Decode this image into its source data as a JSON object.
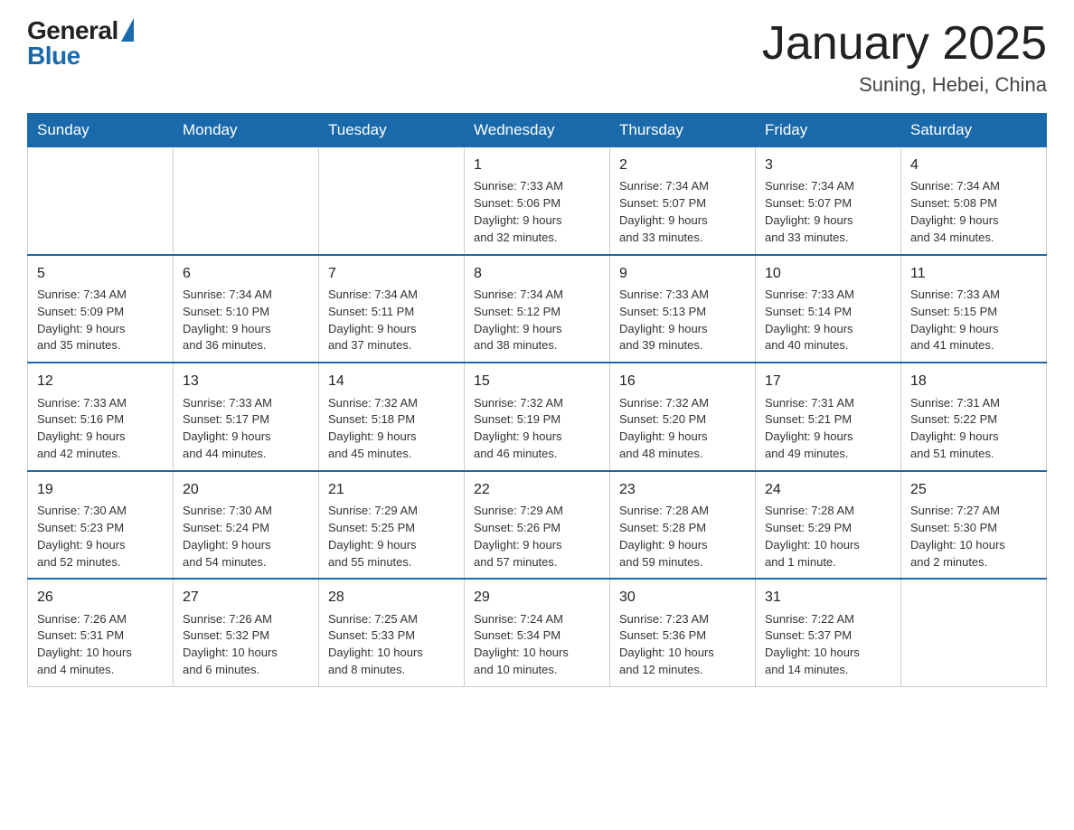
{
  "header": {
    "logo_general": "General",
    "logo_blue": "Blue",
    "month_title": "January 2025",
    "location": "Suning, Hebei, China"
  },
  "weekdays": [
    "Sunday",
    "Monday",
    "Tuesday",
    "Wednesday",
    "Thursday",
    "Friday",
    "Saturday"
  ],
  "weeks": [
    [
      {
        "day": "",
        "info": ""
      },
      {
        "day": "",
        "info": ""
      },
      {
        "day": "",
        "info": ""
      },
      {
        "day": "1",
        "info": "Sunrise: 7:33 AM\nSunset: 5:06 PM\nDaylight: 9 hours\nand 32 minutes."
      },
      {
        "day": "2",
        "info": "Sunrise: 7:34 AM\nSunset: 5:07 PM\nDaylight: 9 hours\nand 33 minutes."
      },
      {
        "day": "3",
        "info": "Sunrise: 7:34 AM\nSunset: 5:07 PM\nDaylight: 9 hours\nand 33 minutes."
      },
      {
        "day": "4",
        "info": "Sunrise: 7:34 AM\nSunset: 5:08 PM\nDaylight: 9 hours\nand 34 minutes."
      }
    ],
    [
      {
        "day": "5",
        "info": "Sunrise: 7:34 AM\nSunset: 5:09 PM\nDaylight: 9 hours\nand 35 minutes."
      },
      {
        "day": "6",
        "info": "Sunrise: 7:34 AM\nSunset: 5:10 PM\nDaylight: 9 hours\nand 36 minutes."
      },
      {
        "day": "7",
        "info": "Sunrise: 7:34 AM\nSunset: 5:11 PM\nDaylight: 9 hours\nand 37 minutes."
      },
      {
        "day": "8",
        "info": "Sunrise: 7:34 AM\nSunset: 5:12 PM\nDaylight: 9 hours\nand 38 minutes."
      },
      {
        "day": "9",
        "info": "Sunrise: 7:33 AM\nSunset: 5:13 PM\nDaylight: 9 hours\nand 39 minutes."
      },
      {
        "day": "10",
        "info": "Sunrise: 7:33 AM\nSunset: 5:14 PM\nDaylight: 9 hours\nand 40 minutes."
      },
      {
        "day": "11",
        "info": "Sunrise: 7:33 AM\nSunset: 5:15 PM\nDaylight: 9 hours\nand 41 minutes."
      }
    ],
    [
      {
        "day": "12",
        "info": "Sunrise: 7:33 AM\nSunset: 5:16 PM\nDaylight: 9 hours\nand 42 minutes."
      },
      {
        "day": "13",
        "info": "Sunrise: 7:33 AM\nSunset: 5:17 PM\nDaylight: 9 hours\nand 44 minutes."
      },
      {
        "day": "14",
        "info": "Sunrise: 7:32 AM\nSunset: 5:18 PM\nDaylight: 9 hours\nand 45 minutes."
      },
      {
        "day": "15",
        "info": "Sunrise: 7:32 AM\nSunset: 5:19 PM\nDaylight: 9 hours\nand 46 minutes."
      },
      {
        "day": "16",
        "info": "Sunrise: 7:32 AM\nSunset: 5:20 PM\nDaylight: 9 hours\nand 48 minutes."
      },
      {
        "day": "17",
        "info": "Sunrise: 7:31 AM\nSunset: 5:21 PM\nDaylight: 9 hours\nand 49 minutes."
      },
      {
        "day": "18",
        "info": "Sunrise: 7:31 AM\nSunset: 5:22 PM\nDaylight: 9 hours\nand 51 minutes."
      }
    ],
    [
      {
        "day": "19",
        "info": "Sunrise: 7:30 AM\nSunset: 5:23 PM\nDaylight: 9 hours\nand 52 minutes."
      },
      {
        "day": "20",
        "info": "Sunrise: 7:30 AM\nSunset: 5:24 PM\nDaylight: 9 hours\nand 54 minutes."
      },
      {
        "day": "21",
        "info": "Sunrise: 7:29 AM\nSunset: 5:25 PM\nDaylight: 9 hours\nand 55 minutes."
      },
      {
        "day": "22",
        "info": "Sunrise: 7:29 AM\nSunset: 5:26 PM\nDaylight: 9 hours\nand 57 minutes."
      },
      {
        "day": "23",
        "info": "Sunrise: 7:28 AM\nSunset: 5:28 PM\nDaylight: 9 hours\nand 59 minutes."
      },
      {
        "day": "24",
        "info": "Sunrise: 7:28 AM\nSunset: 5:29 PM\nDaylight: 10 hours\nand 1 minute."
      },
      {
        "day": "25",
        "info": "Sunrise: 7:27 AM\nSunset: 5:30 PM\nDaylight: 10 hours\nand 2 minutes."
      }
    ],
    [
      {
        "day": "26",
        "info": "Sunrise: 7:26 AM\nSunset: 5:31 PM\nDaylight: 10 hours\nand 4 minutes."
      },
      {
        "day": "27",
        "info": "Sunrise: 7:26 AM\nSunset: 5:32 PM\nDaylight: 10 hours\nand 6 minutes."
      },
      {
        "day": "28",
        "info": "Sunrise: 7:25 AM\nSunset: 5:33 PM\nDaylight: 10 hours\nand 8 minutes."
      },
      {
        "day": "29",
        "info": "Sunrise: 7:24 AM\nSunset: 5:34 PM\nDaylight: 10 hours\nand 10 minutes."
      },
      {
        "day": "30",
        "info": "Sunrise: 7:23 AM\nSunset: 5:36 PM\nDaylight: 10 hours\nand 12 minutes."
      },
      {
        "day": "31",
        "info": "Sunrise: 7:22 AM\nSunset: 5:37 PM\nDaylight: 10 hours\nand 14 minutes."
      },
      {
        "day": "",
        "info": ""
      }
    ]
  ]
}
